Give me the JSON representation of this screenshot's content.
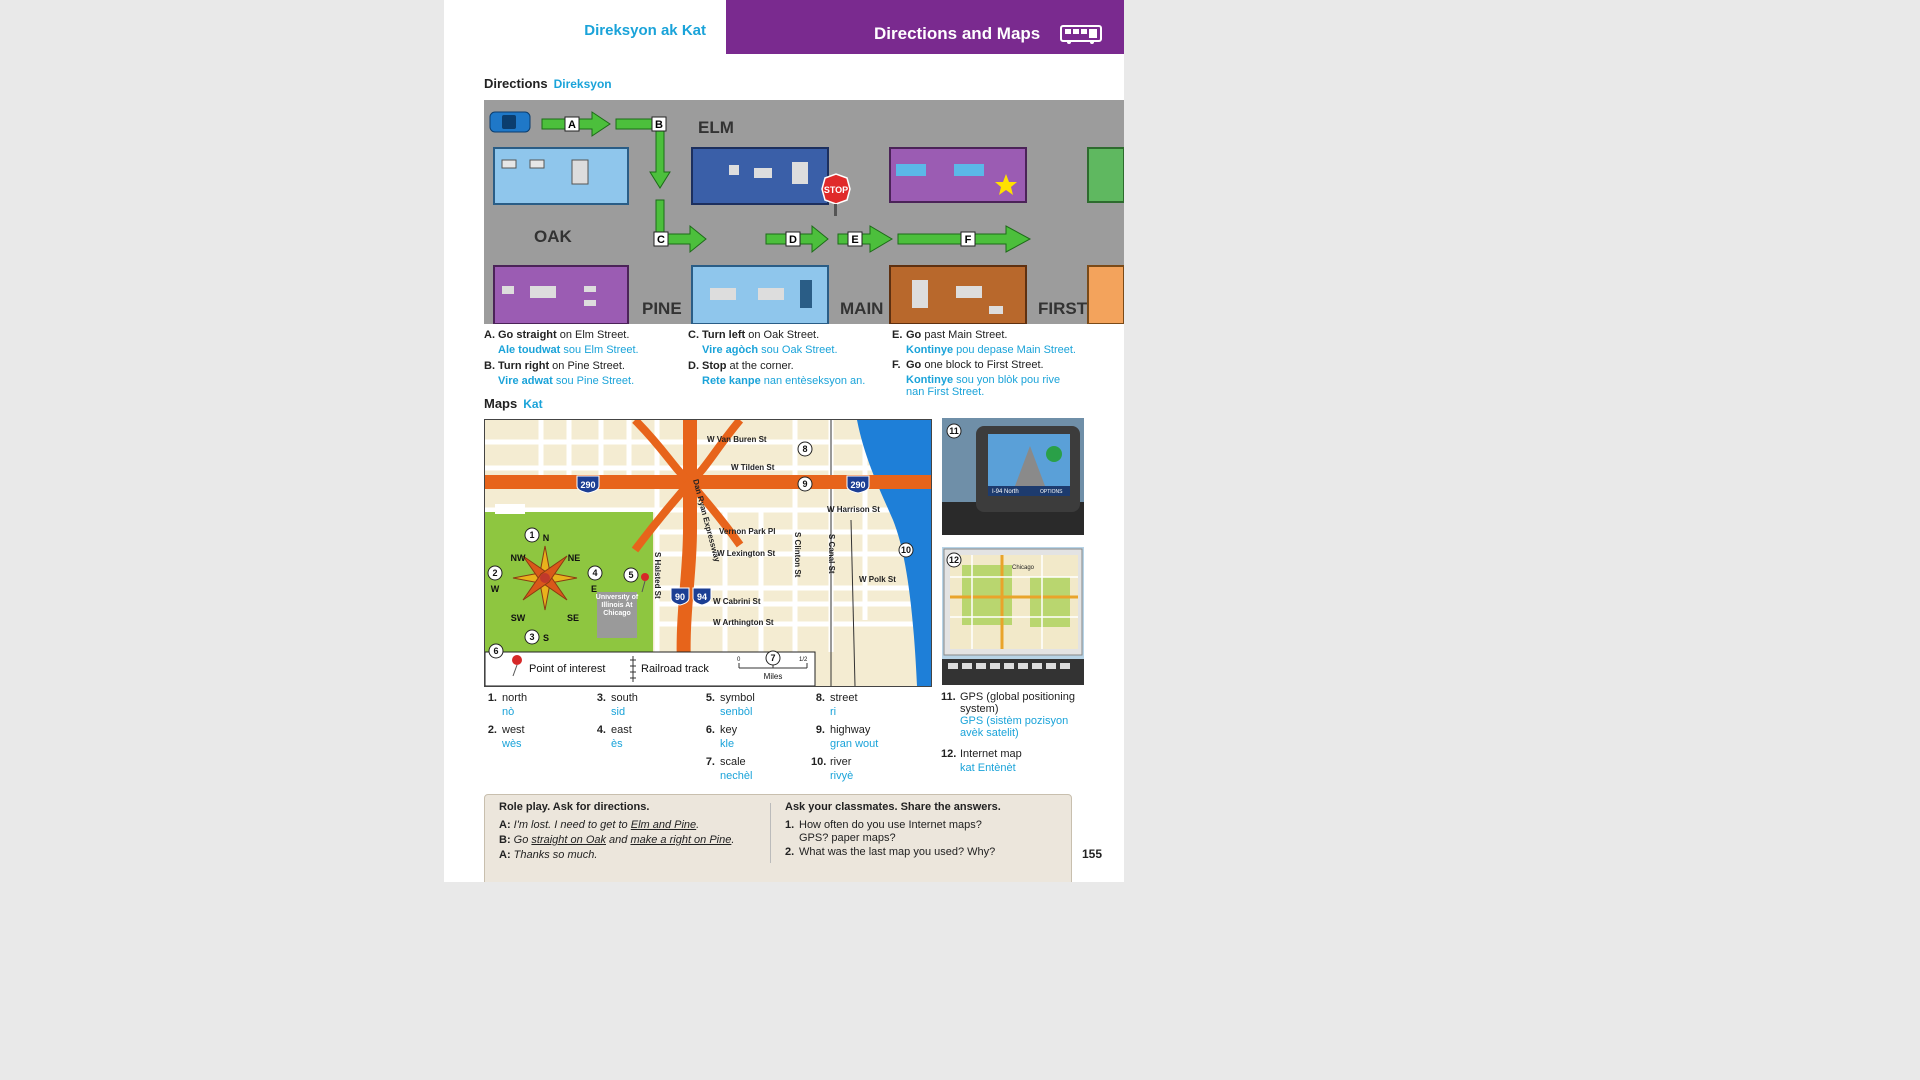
{
  "header": {
    "left_title": "Direksyon ak Kat",
    "right_title": "Directions and Maps",
    "bus_icon": "bus-icon"
  },
  "directions_section": {
    "title": "Directions",
    "title_ht": "Direksyon"
  },
  "street_labels": {
    "elm": "ELM",
    "oak": "OAK",
    "pine": "PINE",
    "main": "MAIN",
    "first": "FIRST",
    "stop": "STOP"
  },
  "route_letters": [
    "A",
    "B",
    "C",
    "D",
    "E",
    "F"
  ],
  "directions": [
    {
      "letter": "A.",
      "bold": "Go straight",
      "rest": " on Elm Street.",
      "ht_bold": "Ale toudwat",
      "ht_rest": " sou Elm Street."
    },
    {
      "letter": "B.",
      "bold": "Turn right",
      "rest": " on Pine Street.",
      "ht_bold": "Vire adwat",
      "ht_rest": " sou Pine Street."
    },
    {
      "letter": "C.",
      "bold": "Turn left",
      "rest": " on Oak Street.",
      "ht_bold": "Vire agòch",
      "ht_rest": " sou Oak Street."
    },
    {
      "letter": "D.",
      "bold": "Stop",
      "rest": " at the corner.",
      "ht_bold": "Rete kanpe",
      "ht_rest": " nan entèseksyon an."
    },
    {
      "letter": "E.",
      "bold": "Go",
      "rest": " past Main Street.",
      "ht_bold": "Kontinye",
      "ht_rest": " pou depase Main Street."
    },
    {
      "letter": "F.",
      "bold": "Go",
      "rest": " one block to First Street.",
      "ht_bold": "Kontinye",
      "ht_rest": " sou yon blòk pou rive nan First Street."
    }
  ],
  "maps_section": {
    "title": "Maps",
    "title_ht": "Kat"
  },
  "map": {
    "streets": [
      "W Van Buren St",
      "W Tilden St",
      "W Harrison St",
      "Vernon Park Pl",
      "W Lexington St",
      "W Polk St",
      "W Cabrini St",
      "W Arthington St",
      "S Halsted St",
      "S Clinton St",
      "S Canal St",
      "Dan Ryan Expressway"
    ],
    "highways": [
      "290",
      "290",
      "90",
      "94"
    ],
    "compass": [
      "N",
      "NE",
      "E",
      "SE",
      "S",
      "SW",
      "W",
      "NW"
    ],
    "university": "University of Illinois At Chicago",
    "key_poi": "Point of interest",
    "key_rail": "Railroad track",
    "key_scale_label": "Miles",
    "scale_ticks": [
      "0",
      "1/2"
    ],
    "callouts": [
      "1",
      "2",
      "3",
      "4",
      "5",
      "6",
      "7",
      "8",
      "9",
      "10"
    ]
  },
  "gps_image": {
    "callout": "11",
    "screen_text": "I-94 North",
    "button": "OPTIONS"
  },
  "internet_map_image": {
    "callout": "12",
    "city": "Chicago"
  },
  "vocab": [
    {
      "n": "1.",
      "en": "north",
      "ht": "nò"
    },
    {
      "n": "2.",
      "en": "west",
      "ht": "wès"
    },
    {
      "n": "3.",
      "en": "south",
      "ht": "sid"
    },
    {
      "n": "4.",
      "en": "east",
      "ht": "ès"
    },
    {
      "n": "5.",
      "en": "symbol",
      "ht": "senbòl"
    },
    {
      "n": "6.",
      "en": "key",
      "ht": "kle"
    },
    {
      "n": "7.",
      "en": "scale",
      "ht": "nechèl"
    },
    {
      "n": "8.",
      "en": "street",
      "ht": "ri"
    },
    {
      "n": "9.",
      "en": "highway",
      "ht": "gran wout"
    },
    {
      "n": "10.",
      "en": "river",
      "ht": "rivyè"
    },
    {
      "n": "11.",
      "en": "GPS (global positioning system)",
      "ht": "GPS (sistèm pozisyon avèk satelit)"
    },
    {
      "n": "12.",
      "en": "Internet map",
      "ht": "kat Entènèt"
    }
  ],
  "roleplay": {
    "title": "Role play. Ask for directions.",
    "lines": [
      {
        "speaker": "A:",
        "parts": [
          "I'm lost. I need to get to ",
          "Elm and Pine",
          "."
        ]
      },
      {
        "speaker": "B:",
        "parts": [
          "Go ",
          "straight on Oak",
          " and ",
          "make a right on Pine",
          "."
        ]
      },
      {
        "speaker": "A:",
        "parts": [
          "Thanks so much."
        ]
      }
    ]
  },
  "classmates": {
    "title": "Ask your classmates. Share the answers.",
    "questions": [
      {
        "n": "1.",
        "text": "How often do you use Internet maps?",
        "text2": "GPS? paper maps?"
      },
      {
        "n": "2.",
        "text": "What was the last map you used? Why?",
        "text2": ""
      }
    ]
  },
  "page_number": "155",
  "colors": {
    "purple": "#7a2a8f",
    "cyan": "#1aa3d9",
    "arrow_green": "#4cbf3c",
    "road_gray": "#9a9a9a"
  }
}
